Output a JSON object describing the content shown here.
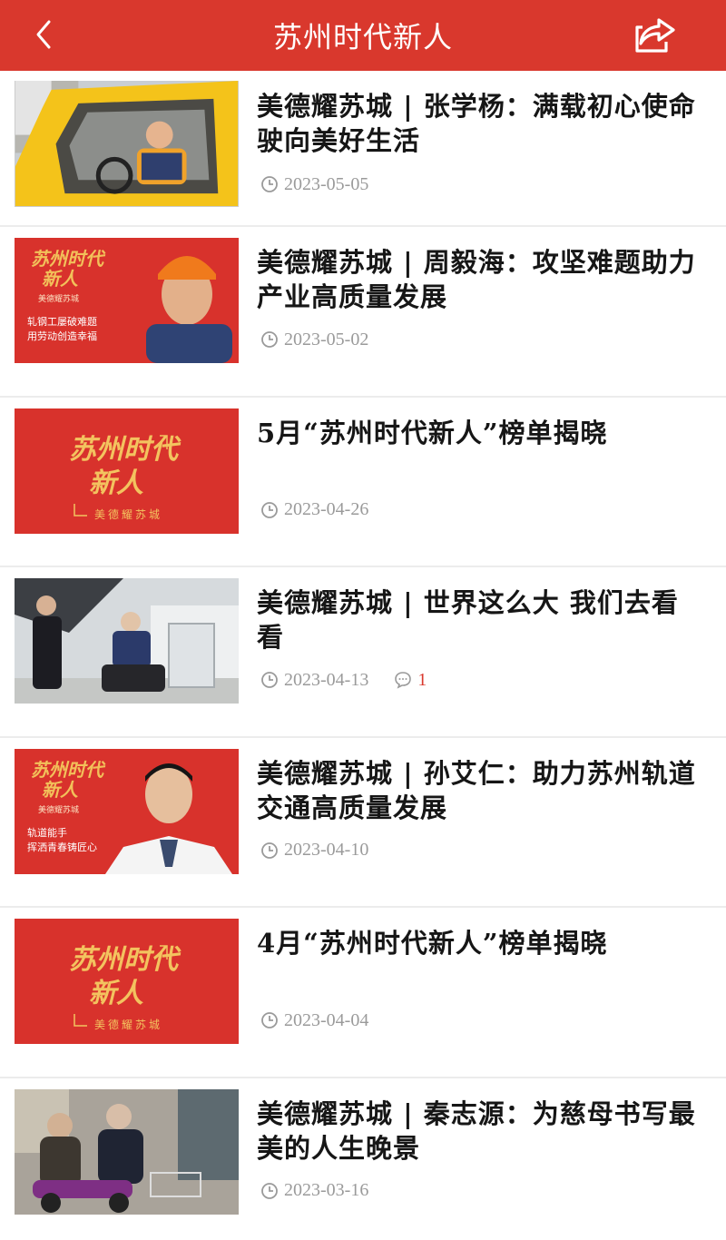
{
  "header": {
    "title": "苏州时代新人",
    "back_icon": "chevron-left-icon",
    "share_icon": "share-icon",
    "color": "#d9382d"
  },
  "articles": [
    {
      "title": "美德耀苏城 | 张学杨：满载初心使命 驶向美好生活",
      "date": "2023-05-05"
    },
    {
      "title": "美德耀苏城 | 周毅海：攻坚难题助力产业高质量发展",
      "date": "2023-05-02",
      "thumb_text": [
        "苏州时代",
        "新人",
        "美德耀苏城",
        "轧钢工屡破难题",
        "用劳动创造幸福"
      ]
    },
    {
      "title": "5月“苏州时代新人”榜单揭晓",
      "date": "2023-04-26",
      "thumb_text": [
        "苏州时代",
        "新人",
        "美德耀苏城"
      ]
    },
    {
      "title": "美德耀苏城 | 世界这么大 我们去看看",
      "date": "2023-04-13",
      "comments": "1"
    },
    {
      "title": "美德耀苏城 | 孙艾仁：助力苏州轨道交通高质量发展",
      "date": "2023-04-10",
      "thumb_text": [
        "苏州时代",
        "新人",
        "美德耀苏城",
        "轨道能手",
        "挥洒青春铸匠心"
      ]
    },
    {
      "title": "4月“苏州时代新人”榜单揭晓",
      "date": "2023-04-04",
      "thumb_text": [
        "苏州时代",
        "新人",
        "美德耀苏城"
      ]
    },
    {
      "title": "美德耀苏城 | 秦志源：为慈母书写最美的人生晚景",
      "date": "2023-03-16"
    }
  ]
}
